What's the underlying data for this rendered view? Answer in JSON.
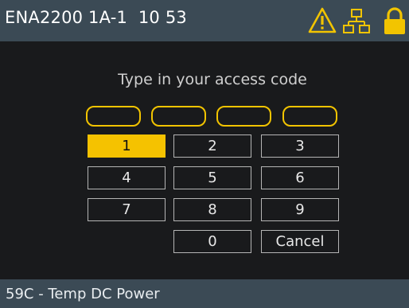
{
  "header": {
    "title": "ENA2200 1A-1  10 53",
    "icons": [
      "warning-icon",
      "network-icon",
      "lock-icon"
    ]
  },
  "keypad": {
    "prompt": "Type in your access code",
    "code_slots": 4,
    "keys": [
      "1",
      "2",
      "3",
      "4",
      "5",
      "6",
      "7",
      "8",
      "9",
      "0",
      "Cancel"
    ],
    "selected_key": "1"
  },
  "footer": {
    "status": "59C - Temp DC Power"
  },
  "colors": {
    "accent": "#f5c200",
    "bar": "#3b4a55",
    "panel": "#191a1c"
  }
}
